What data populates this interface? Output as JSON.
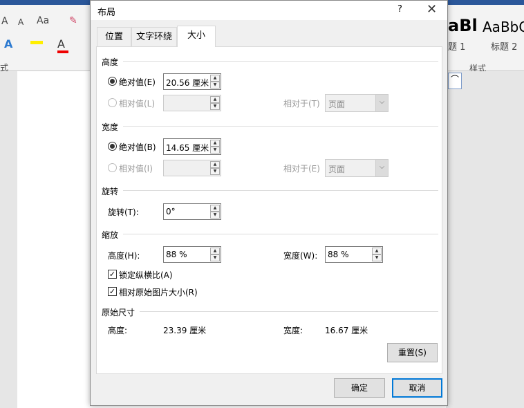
{
  "ribbon": {
    "font_grow": "A",
    "font_shrink": "A",
    "change_case": "Aa",
    "styles": [
      {
        "preview": "aBl",
        "name": "题 1"
      },
      {
        "preview": "AaBbC",
        "name": "标题 2"
      }
    ],
    "styles_group_label": "样式",
    "font_group_label": "式"
  },
  "dialog": {
    "title": "布局",
    "help": "?",
    "close": "✕",
    "tabs": [
      {
        "label": "位置"
      },
      {
        "label": "文字环绕"
      },
      {
        "label": "大小"
      }
    ],
    "height": {
      "section": "高度",
      "absolute_label": "绝对值(E)",
      "absolute_value": "20.56 厘米",
      "relative_label": "相对值(L)",
      "relative_value": "",
      "relative_to_label": "相对于(T)",
      "relative_to_value": "页面"
    },
    "width": {
      "section": "宽度",
      "absolute_label": "绝对值(B)",
      "absolute_value": "14.65 厘米",
      "relative_label": "相对值(I)",
      "relative_value": "",
      "relative_to_label": "相对于(E)",
      "relative_to_value": "页面"
    },
    "rotation": {
      "section": "旋转",
      "label": "旋转(T):",
      "value": "0°"
    },
    "scale": {
      "section": "缩放",
      "height_label": "高度(H):",
      "height_value": "88 %",
      "width_label": "宽度(W):",
      "width_value": "88 %",
      "lock_aspect": "锁定纵横比(A)",
      "relative_original": "相对原始图片大小(R)"
    },
    "original": {
      "section": "原始尺寸",
      "height_label": "高度:",
      "height_value": "23.39 厘米",
      "width_label": "宽度:",
      "width_value": "16.67 厘米"
    },
    "reset": "重置(S)",
    "ok": "确定",
    "cancel": "取消"
  }
}
